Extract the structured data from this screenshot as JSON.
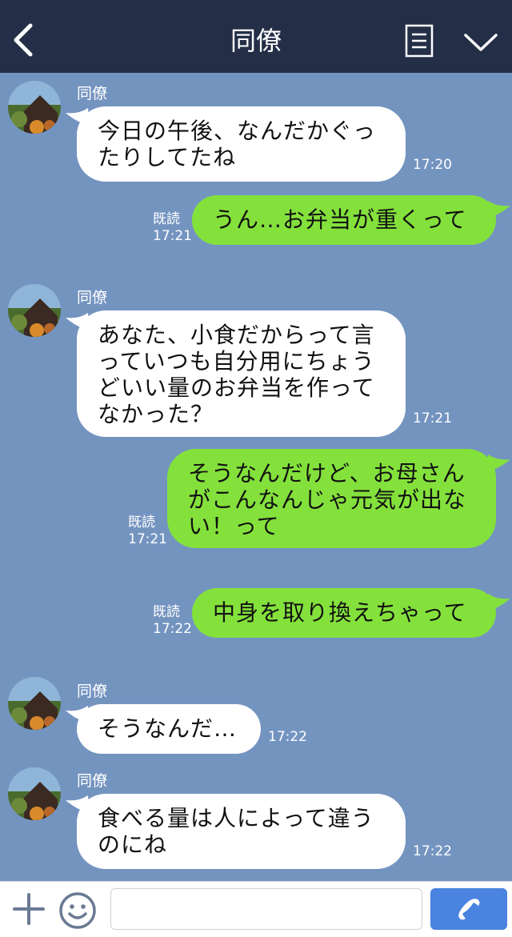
{
  "header": {
    "title": "同僚",
    "back_icon": "chevron-left-icon",
    "menu_icon": "list-icon",
    "collapse_icon": "chevron-down-icon",
    "background": "#242f47"
  },
  "chat": {
    "background": "#7494c0",
    "messages": [
      {
        "direction": "incoming",
        "sender": "同僚",
        "lines": [
          "今日の午後、なんだかぐっ",
          "たりしてたね"
        ],
        "time": "17:20"
      },
      {
        "direction": "outgoing",
        "lines": [
          "うん…お弁当が重くって"
        ],
        "read": "既読",
        "time": "17:21"
      },
      {
        "direction": "incoming",
        "sender": "同僚",
        "lines": [
          "あなた、小食だからって言",
          "っていつも自分用にちょう",
          "どいい量のお弁当を作って",
          "なかった？"
        ],
        "time": "17:21"
      },
      {
        "direction": "outgoing",
        "lines": [
          "そうなんだけど、お母さん",
          "がこんなんじゃ元気が出な",
          "い！って"
        ],
        "read": "既読",
        "time": "17:21"
      },
      {
        "direction": "outgoing",
        "lines": [
          "中身を取り換えちゃって"
        ],
        "read": "既読",
        "time": "17:22"
      },
      {
        "direction": "incoming",
        "sender": "同僚",
        "lines": [
          "そうなんだ…"
        ],
        "time": "17:22"
      },
      {
        "direction": "incoming",
        "sender": "同僚",
        "lines": [
          "食べる量は人によって違う",
          "のにね"
        ],
        "time": "17:22"
      }
    ]
  },
  "input_bar": {
    "plus_icon": "plus-icon",
    "emoji_icon": "smiley-icon",
    "input_value": "",
    "call_icon": "phone-icon",
    "call_color": "#4a83e0"
  },
  "colors": {
    "incoming_bubble": "#ffffff",
    "outgoing_bubble": "#84e13c"
  }
}
